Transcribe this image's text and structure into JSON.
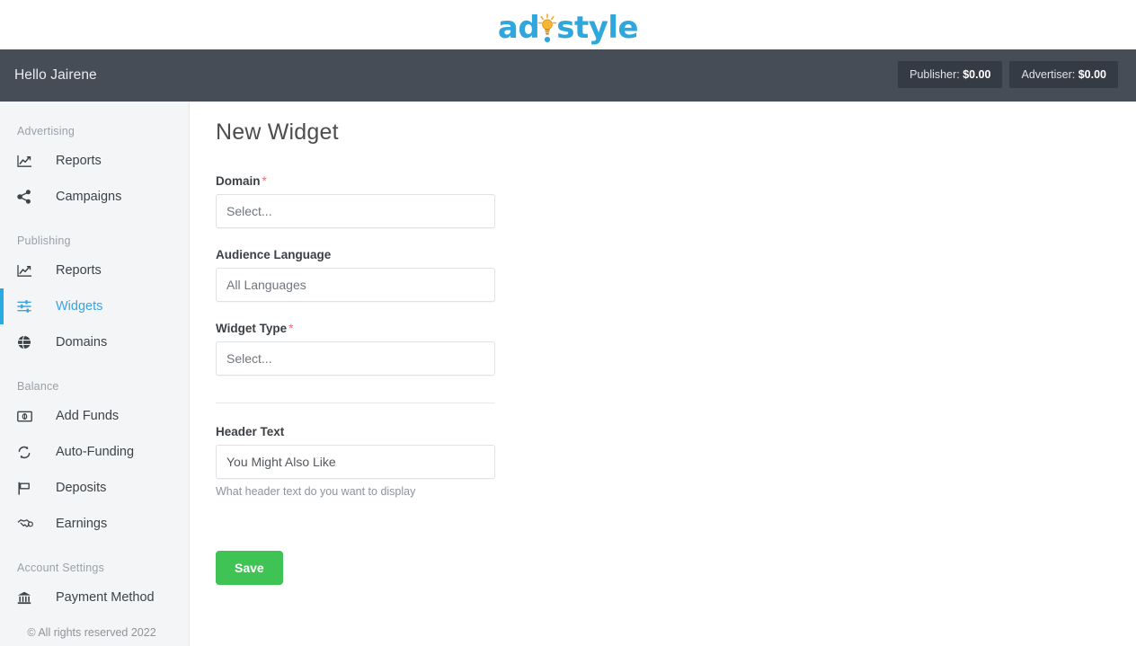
{
  "brand": {
    "logo_part1": "ad",
    "logo_part2": "style",
    "logo_icon": "lightbulb-icon",
    "logo_color": "#2fa7dd",
    "bulb_color": "#f5a623"
  },
  "topbar": {
    "greeting": "Hello Jairene",
    "balances": [
      {
        "label": "Publisher:",
        "amount": "$0.00"
      },
      {
        "label": "Advertiser:",
        "amount": "$0.00"
      }
    ]
  },
  "sidebar": {
    "sections": [
      {
        "title": "Advertising",
        "items": [
          {
            "label": "Reports",
            "icon": "chart-line-icon",
            "active": false
          },
          {
            "label": "Campaigns",
            "icon": "share-nodes-icon",
            "active": false
          }
        ]
      },
      {
        "title": "Publishing",
        "items": [
          {
            "label": "Reports",
            "icon": "chart-line-icon",
            "active": false
          },
          {
            "label": "Widgets",
            "icon": "sliders-icon",
            "active": true
          },
          {
            "label": "Domains",
            "icon": "globe-icon",
            "active": false
          }
        ]
      },
      {
        "title": "Balance",
        "items": [
          {
            "label": "Add Funds",
            "icon": "money-bill-icon",
            "active": false
          },
          {
            "label": "Auto-Funding",
            "icon": "sync-arrows-icon",
            "active": false
          },
          {
            "label": "Deposits",
            "icon": "flag-icon",
            "active": false
          },
          {
            "label": "Earnings",
            "icon": "handshake-icon",
            "active": false
          }
        ]
      },
      {
        "title": "Account Settings",
        "items": [
          {
            "label": "Payment Method",
            "icon": "bank-icon",
            "active": false
          }
        ]
      }
    ],
    "copyright": "© All rights reserved 2022",
    "active_color": "#29abe2"
  },
  "main": {
    "title": "New Widget",
    "fields": {
      "domain": {
        "label": "Domain",
        "required": "*",
        "placeholder": "Select..."
      },
      "audience_language": {
        "label": "Audience Language",
        "required": "",
        "placeholder": "All Languages"
      },
      "widget_type": {
        "label": "Widget Type",
        "required": "*",
        "placeholder": "Select..."
      },
      "header_text": {
        "label": "Header Text",
        "required": "",
        "value": "You Might Also Like",
        "help": "What header text do you want to display"
      }
    },
    "save_label": "Save",
    "save_color": "#3fc355"
  }
}
